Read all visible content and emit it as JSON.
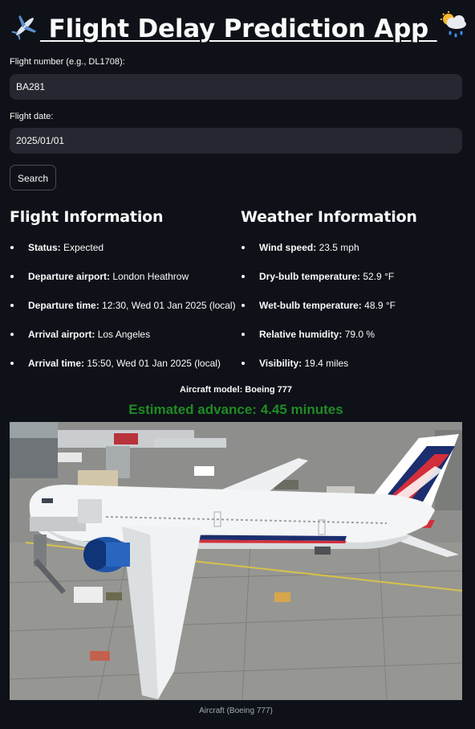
{
  "header": {
    "title": "Flight Delay Prediction App",
    "left_icon": "airplane-icon",
    "right_icon": "sun-behind-rain-cloud-icon"
  },
  "form": {
    "flight_number_label": "Flight number (e.g., DL1708):",
    "flight_number_value": "BA281",
    "flight_date_label": "Flight date:",
    "flight_date_value": "2025/01/01",
    "search_label": "Search"
  },
  "flight_info": {
    "title": "Flight Information",
    "items": [
      {
        "label": "Status:",
        "value": "Expected"
      },
      {
        "label": "Departure airport:",
        "value": "London Heathrow"
      },
      {
        "label": "Departure time:",
        "value": "12:30, Wed 01 Jan 2025 (local)"
      },
      {
        "label": "Arrival airport:",
        "value": "Los Angeles"
      },
      {
        "label": "Arrival time:",
        "value": "15:50, Wed 01 Jan 2025 (local)"
      }
    ]
  },
  "weather_info": {
    "title": "Weather Information",
    "items": [
      {
        "label": "Wind speed:",
        "value": "23.5 mph"
      },
      {
        "label": "Dry-bulb temperature:",
        "value": "52.9 °F"
      },
      {
        "label": "Wet-bulb temperature:",
        "value": "48.9 °F"
      },
      {
        "label": "Relative humidity:",
        "value": "79.0 %"
      },
      {
        "label": "Visibility:",
        "value": "19.4 miles"
      }
    ]
  },
  "result": {
    "aircraft_model": "Aircraft model: Boeing 777",
    "estimate": "Estimated advance: 4.45 minutes"
  },
  "image": {
    "caption": "Aircraft (Boeing 777)"
  },
  "colors": {
    "background": "#0e1117",
    "input_background": "#262730",
    "estimate_green": "#1f8b24",
    "text": "#fafafa"
  }
}
